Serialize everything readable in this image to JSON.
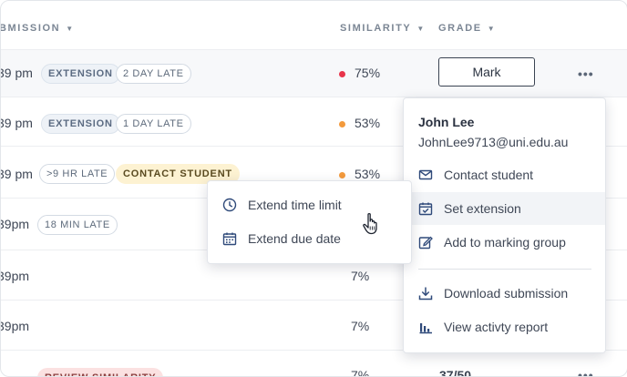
{
  "headers": {
    "submission": "BMISSION",
    "similarity": "SIMILARITY",
    "grade": "GRADE"
  },
  "rows": [
    {
      "time": "39 pm",
      "tags": [
        "EXTENSION",
        "2 DAY LATE"
      ],
      "similarity": "75%",
      "dot_color": "#e8344a"
    },
    {
      "time": "39 pm",
      "tags": [
        "EXTENSION",
        "1 DAY LATE"
      ],
      "similarity": "53%",
      "dot_color": "#f39a3c"
    },
    {
      "time": "39 pm",
      "tags": [
        ">9 HR LATE",
        "CONTACT STUDENT"
      ],
      "similarity": "53%",
      "dot_color": "#f39a3c"
    },
    {
      "time": "39pm",
      "tags": [
        "18 MIN LATE"
      ],
      "similarity": ""
    },
    {
      "time": "39pm",
      "tags": [],
      "similarity": "7%"
    },
    {
      "time": "39pm",
      "tags": [],
      "similarity": "7%"
    },
    {
      "time": "",
      "tags": [
        "REVIEW SIMILARITY"
      ],
      "similarity": "7%",
      "grade": "37/50"
    }
  ],
  "mark_button": "Mark",
  "more_label": "•••",
  "student_menu": {
    "name": "John Lee",
    "email": "JohnLee9713@uni.edu.au",
    "items": [
      {
        "label": "Contact student",
        "icon": "envelope-icon"
      },
      {
        "label": "Set extension",
        "icon": "calendar-check-icon"
      },
      {
        "label": "Add to marking group",
        "icon": "edit-square-icon"
      },
      {
        "label": "Download submission",
        "icon": "download-icon"
      },
      {
        "label": "View activty report",
        "icon": "bar-chart-icon"
      }
    ]
  },
  "extension_menu": {
    "items": [
      {
        "label": "Extend time limit",
        "icon": "clock-icon"
      },
      {
        "label": "Extend due date",
        "icon": "calendar-icon"
      }
    ]
  },
  "colors": {
    "accent_icon": "#2f4a7a",
    "high_similarity": "#e8344a",
    "medium_similarity": "#f39a3c"
  }
}
